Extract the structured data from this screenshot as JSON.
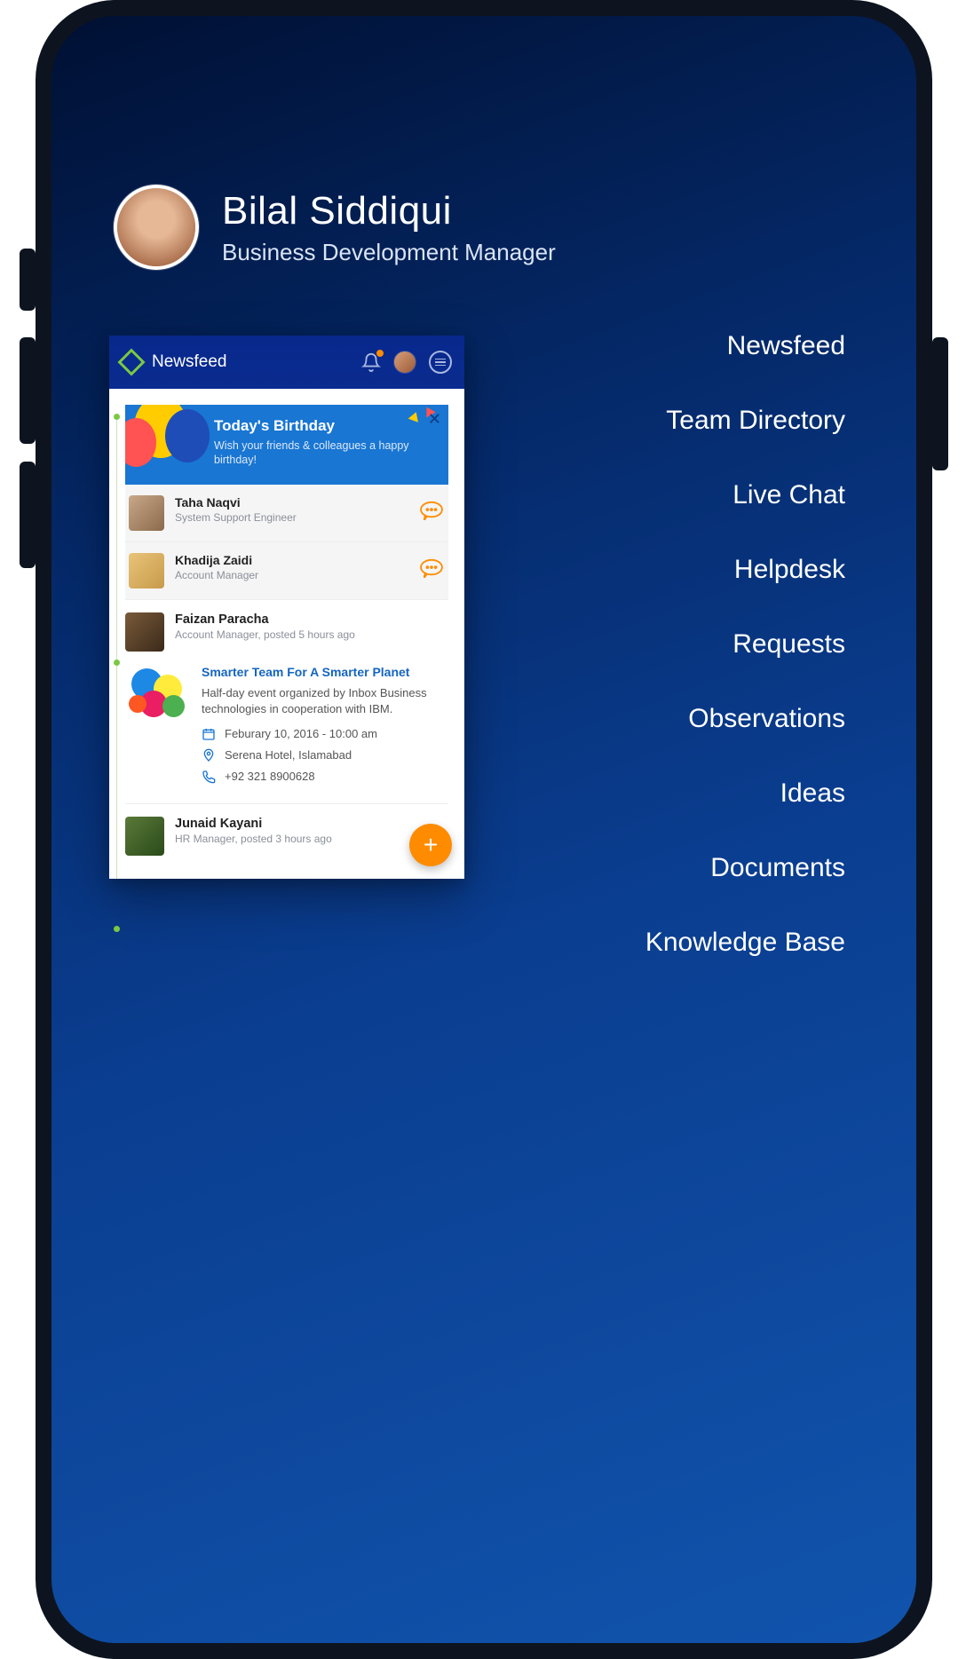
{
  "profile": {
    "name": "Bilal Siddiqui",
    "role": "Business Development Manager"
  },
  "menu": {
    "items": [
      {
        "label": "Newsfeed"
      },
      {
        "label": "Team Directory"
      },
      {
        "label": "Live Chat"
      },
      {
        "label": "Helpdesk"
      },
      {
        "label": "Requests"
      },
      {
        "label": "Observations"
      },
      {
        "label": "Ideas"
      },
      {
        "label": "Documents"
      },
      {
        "label": "Knowledge Base"
      }
    ]
  },
  "newsfeed": {
    "header_title": "Newsfeed",
    "birthday": {
      "title": "Today's Birthday",
      "subtitle": "Wish your friends & colleagues a happy birthday!",
      "people": [
        {
          "name": "Taha Naqvi",
          "role": "System Support Engineer"
        },
        {
          "name": "Khadija Zaidi",
          "role": "Account Manager"
        }
      ]
    },
    "posts": [
      {
        "author": "Faizan Paracha",
        "meta": "Account Manager, posted 5 hours ago",
        "title": "Smarter Team For A Smarter Planet",
        "description": "Half-day event organized by Inbox Business technologies in cooperation with IBM.",
        "date": "Feburary 10, 2016 - 10:00 am",
        "location": "Serena Hotel, Islamabad",
        "phone": "+92 321 8900628"
      },
      {
        "author": "Junaid Kayani",
        "meta": "HR Manager, posted 3 hours ago"
      }
    ],
    "fab_label": "+"
  }
}
